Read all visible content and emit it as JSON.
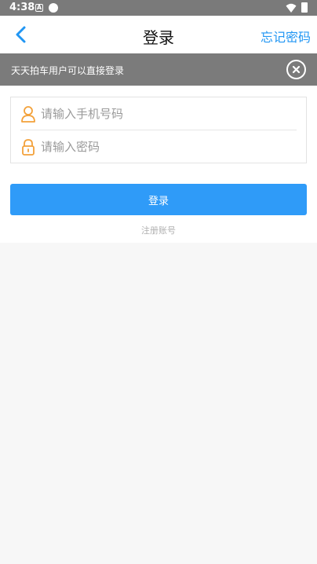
{
  "status_bar": {
    "time": "4:38",
    "notif_icon_letter": "A"
  },
  "header": {
    "title": "登录",
    "forgot_password": "忘记密码",
    "back_icon": "chevron-left-icon"
  },
  "notice": {
    "text": "天天拍车用户可以直接登录",
    "close_icon": "close-circle-icon"
  },
  "form": {
    "phone": {
      "placeholder": "请输入手机号码",
      "value": "",
      "icon": "user-icon"
    },
    "password": {
      "placeholder": "请输入密码",
      "value": "",
      "icon": "lock-icon"
    }
  },
  "login_button": "登录",
  "register_link": "注册账号",
  "colors": {
    "accent": "#2196f3",
    "button": "#2f9bf8",
    "icon_orange": "#f3a13a",
    "gray_bar": "#7b7b7b"
  }
}
